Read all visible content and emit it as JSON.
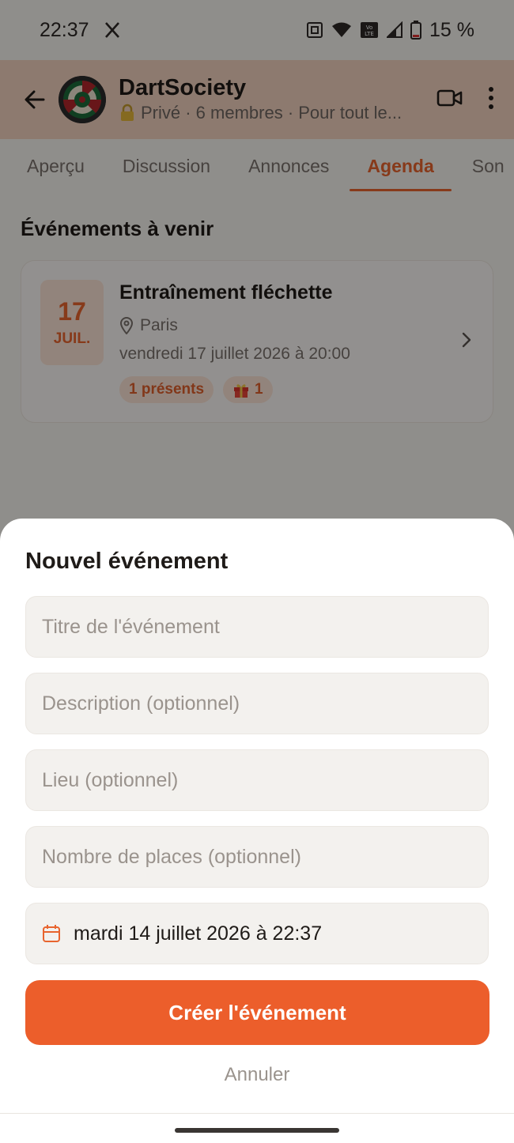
{
  "status_bar": {
    "time": "22:37",
    "battery": "15 %"
  },
  "header": {
    "group_name": "DartSociety",
    "group_meta": "Privé · 6 membres · Pour tout le..."
  },
  "tabs": [
    {
      "label": "Aperçu"
    },
    {
      "label": "Discussion"
    },
    {
      "label": "Annonces"
    },
    {
      "label": "Agenda"
    },
    {
      "label": "Son"
    }
  ],
  "active_tab": "Agenda",
  "events_section": {
    "title": "Événements à venir",
    "event": {
      "day": "17",
      "month": "JUIL.",
      "title": "Entraînement fléchette",
      "place": "Paris",
      "datetime": "vendredi 17 juillet 2026 à 20:00",
      "present_badge": "1 présents",
      "gift_count": "1"
    }
  },
  "sheet": {
    "title": "Nouvel événement",
    "title_placeholder": "Titre de l'événement",
    "description_placeholder": "Description (optionnel)",
    "place_placeholder": "Lieu (optionnel)",
    "seats_placeholder": "Nombre de places (optionnel)",
    "date_value": "mardi 14 juillet 2026 à 22:37",
    "create_label": "Créer l'événement",
    "cancel_label": "Annuler"
  },
  "colors": {
    "accent": "#ec5e2b",
    "header_bg": "#f3d3c0",
    "badge_bg": "#fbe3d6"
  }
}
